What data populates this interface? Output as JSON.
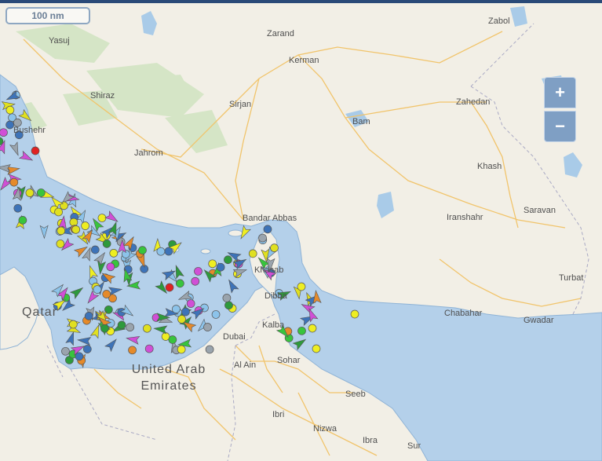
{
  "scale_label": "100 nm",
  "zoom": {
    "in": "+",
    "out": "−"
  },
  "cities": [
    {
      "name": "Yasuj"
    },
    {
      "name": "Zarand"
    },
    {
      "name": "Zabol"
    },
    {
      "name": "Kerman"
    },
    {
      "name": "Shiraz"
    },
    {
      "name": "Sirjan"
    },
    {
      "name": "Zahedan"
    },
    {
      "name": "Bam"
    },
    {
      "name": "Bushehr"
    },
    {
      "name": "Jahrom"
    },
    {
      "name": "Khash"
    },
    {
      "name": "Bandar Abbas"
    },
    {
      "name": "Iranshahr"
    },
    {
      "name": "Saravan"
    },
    {
      "name": "Khasab"
    },
    {
      "name": "Turbat"
    },
    {
      "name": "Dibba"
    },
    {
      "name": "Chabahar"
    },
    {
      "name": "Gwadar"
    },
    {
      "name": "Kalba"
    },
    {
      "name": "Dubai"
    },
    {
      "name": "Sohar"
    },
    {
      "name": "Al Ain"
    },
    {
      "name": "Seeb"
    },
    {
      "name": "Ibri"
    },
    {
      "name": "Nizwa"
    },
    {
      "name": "Ibra"
    },
    {
      "name": "Sur"
    }
  ],
  "countries": {
    "qatar": "Qatar",
    "uae_line1": "United Arab",
    "uae_line2": "Emirates"
  },
  "vessel_colors": {
    "cargo": "#3d73b8",
    "tanker": "#9aa4ad",
    "passenger": "#2e9a3c",
    "fishing": "#eeee22",
    "high_speed": "#e0e020",
    "pleasure": "#d04fd6",
    "tug_special": "#e58a2a",
    "sailing": "#38c43d",
    "unknown": "#8cc3ea",
    "navaids": "#e02222"
  }
}
